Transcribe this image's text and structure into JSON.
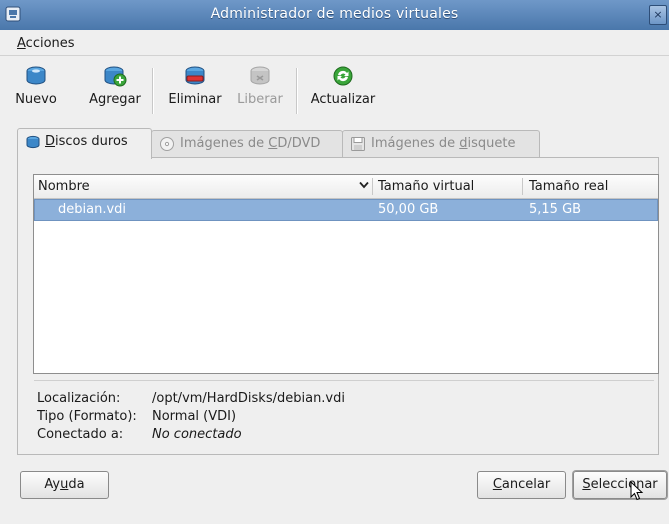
{
  "window": {
    "title": "Administrador de medios virtuales",
    "close_glyph": "×"
  },
  "menubar": {
    "acciones": {
      "hot": "A",
      "rest": "cciones"
    }
  },
  "toolbar": {
    "nuevo": "Nuevo",
    "agregar": "Agregar",
    "eliminar": "Eliminar",
    "liberar": "Liberar",
    "actualizar": "Actualizar"
  },
  "tabs": {
    "hd": {
      "hot": "D",
      "rest": "iscos duros"
    },
    "cd": {
      "pre": "Imágenes de ",
      "hot": "C",
      "rest": "D/DVD"
    },
    "fd": {
      "pre": "Imágenes de ",
      "hot": "d",
      "rest": "isquete"
    }
  },
  "list": {
    "headers": {
      "name": "Nombre",
      "virtual": "Tamaño virtual",
      "real": "Tamaño real"
    },
    "rows": [
      {
        "name": "debian.vdi",
        "virtual": "50,00 GB",
        "real": "5,15 GB"
      }
    ]
  },
  "details": {
    "location_label": "Localización:",
    "location_value": "/opt/vm/HardDisks/debian.vdi",
    "type_label": "Tipo (Formato):",
    "type_value": "Normal (VDI)",
    "attached_label": "Conectado a:",
    "attached_value": "No conectado"
  },
  "buttons": {
    "help": {
      "pre": "Ay",
      "hot": "u",
      "rest": "da"
    },
    "cancel": {
      "hot": "C",
      "rest": "ancelar"
    },
    "select": {
      "hot": "S",
      "rest": "eleccionar"
    }
  },
  "colors": {
    "selection": "#8cb0da",
    "titlebar": "#5a86bb",
    "accent_green": "#3aa53a"
  }
}
